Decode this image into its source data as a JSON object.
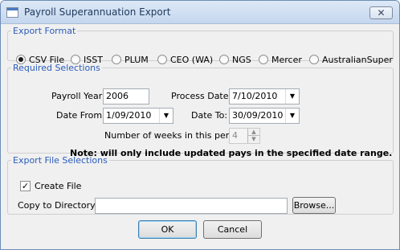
{
  "window": {
    "title": "Payroll Superannuation Export",
    "close_glyph": "✕"
  },
  "export_format": {
    "legend": "Export Format",
    "options": [
      {
        "label": "CSV File",
        "checked": true
      },
      {
        "label": "ISST",
        "checked": false
      },
      {
        "label": "PLUM",
        "checked": false
      },
      {
        "label": "CEO (WA)",
        "checked": false
      },
      {
        "label": "NGS",
        "checked": false
      },
      {
        "label": "Mercer",
        "checked": false
      },
      {
        "label": "AustralianSuper",
        "checked": false
      }
    ]
  },
  "required": {
    "legend": "Required Selections",
    "payroll_year_label": "Payroll Year:",
    "payroll_year_value": "2006",
    "process_date_label": "Process Date:",
    "process_date_value": "7/10/2010",
    "date_from_label": "Date From:",
    "date_from_value": "1/09/2010",
    "date_to_label": "Date To:",
    "date_to_value": "30/09/2010",
    "weeks_label": "Number of weeks in this period:",
    "weeks_value": "4",
    "note": "Note: will only include updated pays in the specified date range."
  },
  "export_file": {
    "legend": "Export File Selections",
    "create_file_label": "Create File",
    "create_file_checked": true,
    "check_glyph": "✓",
    "copy_dir_label": "Copy to Directory:",
    "copy_dir_value": "",
    "browse_label": "Browse..."
  },
  "footer": {
    "ok_label": "OK",
    "cancel_label": "Cancel"
  },
  "icons": {
    "dropdown": "▼",
    "spin_up": "▲",
    "spin_down": "▼"
  }
}
